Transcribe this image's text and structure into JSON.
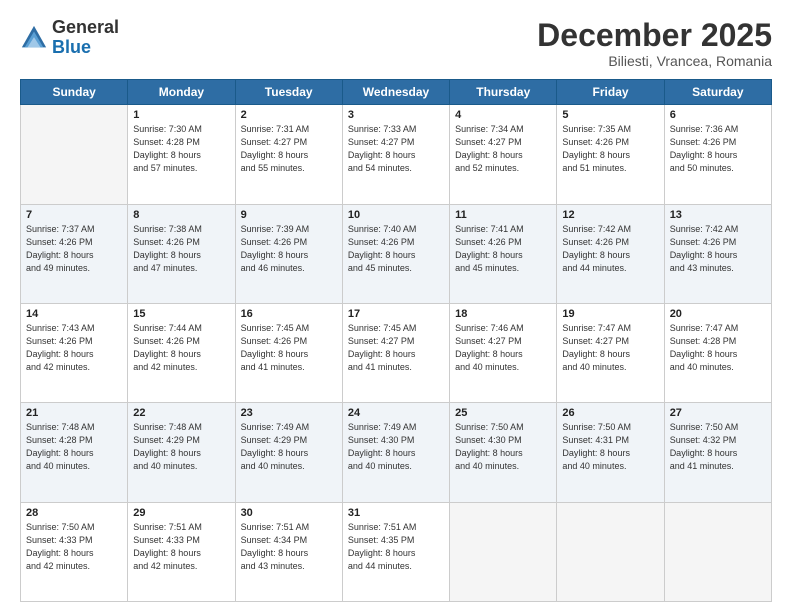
{
  "logo": {
    "general": "General",
    "blue": "Blue"
  },
  "title": "December 2025",
  "subtitle": "Biliesti, Vrancea, Romania",
  "days_header": [
    "Sunday",
    "Monday",
    "Tuesday",
    "Wednesday",
    "Thursday",
    "Friday",
    "Saturday"
  ],
  "weeks": [
    [
      {
        "day": "",
        "info": ""
      },
      {
        "day": "1",
        "info": "Sunrise: 7:30 AM\nSunset: 4:28 PM\nDaylight: 8 hours\nand 57 minutes."
      },
      {
        "day": "2",
        "info": "Sunrise: 7:31 AM\nSunset: 4:27 PM\nDaylight: 8 hours\nand 55 minutes."
      },
      {
        "day": "3",
        "info": "Sunrise: 7:33 AM\nSunset: 4:27 PM\nDaylight: 8 hours\nand 54 minutes."
      },
      {
        "day": "4",
        "info": "Sunrise: 7:34 AM\nSunset: 4:27 PM\nDaylight: 8 hours\nand 52 minutes."
      },
      {
        "day": "5",
        "info": "Sunrise: 7:35 AM\nSunset: 4:26 PM\nDaylight: 8 hours\nand 51 minutes."
      },
      {
        "day": "6",
        "info": "Sunrise: 7:36 AM\nSunset: 4:26 PM\nDaylight: 8 hours\nand 50 minutes."
      }
    ],
    [
      {
        "day": "7",
        "info": "Sunrise: 7:37 AM\nSunset: 4:26 PM\nDaylight: 8 hours\nand 49 minutes."
      },
      {
        "day": "8",
        "info": "Sunrise: 7:38 AM\nSunset: 4:26 PM\nDaylight: 8 hours\nand 47 minutes."
      },
      {
        "day": "9",
        "info": "Sunrise: 7:39 AM\nSunset: 4:26 PM\nDaylight: 8 hours\nand 46 minutes."
      },
      {
        "day": "10",
        "info": "Sunrise: 7:40 AM\nSunset: 4:26 PM\nDaylight: 8 hours\nand 45 minutes."
      },
      {
        "day": "11",
        "info": "Sunrise: 7:41 AM\nSunset: 4:26 PM\nDaylight: 8 hours\nand 45 minutes."
      },
      {
        "day": "12",
        "info": "Sunrise: 7:42 AM\nSunset: 4:26 PM\nDaylight: 8 hours\nand 44 minutes."
      },
      {
        "day": "13",
        "info": "Sunrise: 7:42 AM\nSunset: 4:26 PM\nDaylight: 8 hours\nand 43 minutes."
      }
    ],
    [
      {
        "day": "14",
        "info": "Sunrise: 7:43 AM\nSunset: 4:26 PM\nDaylight: 8 hours\nand 42 minutes."
      },
      {
        "day": "15",
        "info": "Sunrise: 7:44 AM\nSunset: 4:26 PM\nDaylight: 8 hours\nand 42 minutes."
      },
      {
        "day": "16",
        "info": "Sunrise: 7:45 AM\nSunset: 4:26 PM\nDaylight: 8 hours\nand 41 minutes."
      },
      {
        "day": "17",
        "info": "Sunrise: 7:45 AM\nSunset: 4:27 PM\nDaylight: 8 hours\nand 41 minutes."
      },
      {
        "day": "18",
        "info": "Sunrise: 7:46 AM\nSunset: 4:27 PM\nDaylight: 8 hours\nand 40 minutes."
      },
      {
        "day": "19",
        "info": "Sunrise: 7:47 AM\nSunset: 4:27 PM\nDaylight: 8 hours\nand 40 minutes."
      },
      {
        "day": "20",
        "info": "Sunrise: 7:47 AM\nSunset: 4:28 PM\nDaylight: 8 hours\nand 40 minutes."
      }
    ],
    [
      {
        "day": "21",
        "info": "Sunrise: 7:48 AM\nSunset: 4:28 PM\nDaylight: 8 hours\nand 40 minutes."
      },
      {
        "day": "22",
        "info": "Sunrise: 7:48 AM\nSunset: 4:29 PM\nDaylight: 8 hours\nand 40 minutes."
      },
      {
        "day": "23",
        "info": "Sunrise: 7:49 AM\nSunset: 4:29 PM\nDaylight: 8 hours\nand 40 minutes."
      },
      {
        "day": "24",
        "info": "Sunrise: 7:49 AM\nSunset: 4:30 PM\nDaylight: 8 hours\nand 40 minutes."
      },
      {
        "day": "25",
        "info": "Sunrise: 7:50 AM\nSunset: 4:30 PM\nDaylight: 8 hours\nand 40 minutes."
      },
      {
        "day": "26",
        "info": "Sunrise: 7:50 AM\nSunset: 4:31 PM\nDaylight: 8 hours\nand 40 minutes."
      },
      {
        "day": "27",
        "info": "Sunrise: 7:50 AM\nSunset: 4:32 PM\nDaylight: 8 hours\nand 41 minutes."
      }
    ],
    [
      {
        "day": "28",
        "info": "Sunrise: 7:50 AM\nSunset: 4:33 PM\nDaylight: 8 hours\nand 42 minutes."
      },
      {
        "day": "29",
        "info": "Sunrise: 7:51 AM\nSunset: 4:33 PM\nDaylight: 8 hours\nand 42 minutes."
      },
      {
        "day": "30",
        "info": "Sunrise: 7:51 AM\nSunset: 4:34 PM\nDaylight: 8 hours\nand 43 minutes."
      },
      {
        "day": "31",
        "info": "Sunrise: 7:51 AM\nSunset: 4:35 PM\nDaylight: 8 hours\nand 44 minutes."
      },
      {
        "day": "",
        "info": ""
      },
      {
        "day": "",
        "info": ""
      },
      {
        "day": "",
        "info": ""
      }
    ]
  ]
}
